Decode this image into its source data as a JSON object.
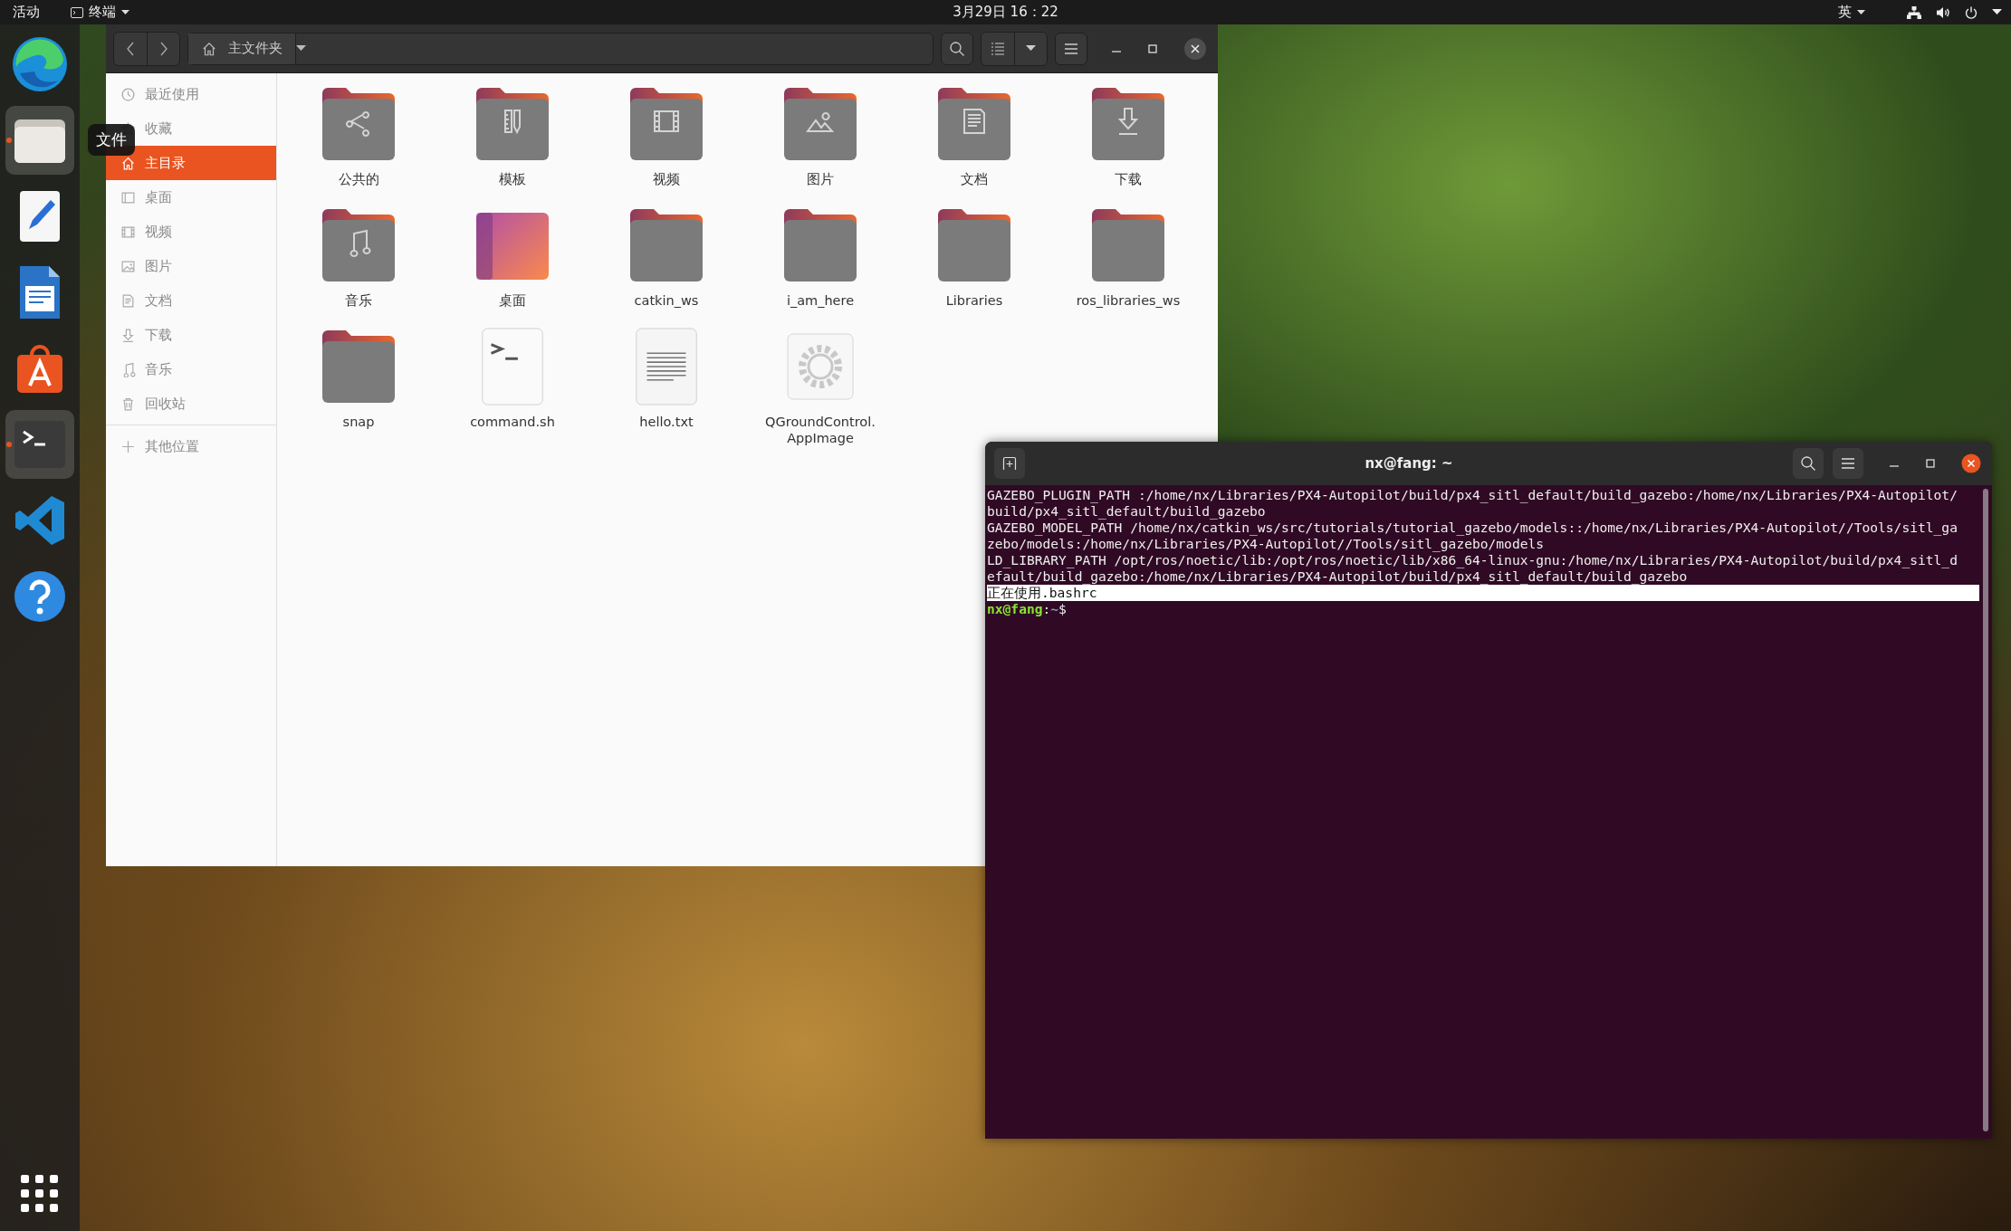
{
  "top_bar": {
    "activities": "活动",
    "app_menu": "终端",
    "clock": "3月29日 16：22",
    "input_method": "英"
  },
  "dock": [
    {
      "running": false,
      "highlighted": false
    },
    {
      "running": true,
      "highlighted": true
    },
    {
      "running": false,
      "highlighted": false
    },
    {
      "running": false,
      "highlighted": false
    },
    {
      "running": false,
      "highlighted": false
    },
    {
      "running": true,
      "highlighted": true
    },
    {
      "running": false,
      "highlighted": false
    },
    {
      "running": false,
      "highlighted": false
    }
  ],
  "dock_tooltip": "文件",
  "files_window": {
    "path": "主文件夹",
    "sidebar": [
      {
        "label": "最近使用",
        "selected": false
      },
      {
        "label": "收藏",
        "selected": false
      },
      {
        "label": "主目录",
        "selected": true
      },
      {
        "label": "桌面",
        "selected": false
      },
      {
        "label": "视频",
        "selected": false
      },
      {
        "label": "图片",
        "selected": false
      },
      {
        "label": "文档",
        "selected": false
      },
      {
        "label": "下载",
        "selected": false
      },
      {
        "label": "音乐",
        "selected": false
      },
      {
        "label": "回收站",
        "selected": false
      }
    ],
    "other_locations": "其他位置",
    "items": [
      {
        "name": "公共的",
        "kind": "folder"
      },
      {
        "name": "模板",
        "kind": "folder"
      },
      {
        "name": "视频",
        "kind": "folder"
      },
      {
        "name": "图片",
        "kind": "folder"
      },
      {
        "name": "文档",
        "kind": "folder"
      },
      {
        "name": "下载",
        "kind": "folder"
      },
      {
        "name": "音乐",
        "kind": "folder"
      },
      {
        "name": "桌面",
        "kind": "desktop"
      },
      {
        "name": "catkin_ws",
        "kind": "folder"
      },
      {
        "name": "i_am_here",
        "kind": "folder"
      },
      {
        "name": "Libraries",
        "kind": "folder"
      },
      {
        "name": "ros_libraries_ws",
        "kind": "folder"
      },
      {
        "name": "snap",
        "kind": "folder"
      },
      {
        "name": "command.sh",
        "kind": "script"
      },
      {
        "name": "hello.txt",
        "kind": "text"
      },
      {
        "name": "QGroundControl.\nAppImage",
        "kind": "app"
      }
    ]
  },
  "terminal": {
    "title": "nx@fang: ~",
    "lines": [
      {
        "text": "GAZEBO_PLUGIN_PATH :/home/nx/Libraries/PX4-Autopilot/build/px4_sitl_default/build_gazebo:/home/nx/Libraries/PX4-Autopilot/",
        "highlighted": false
      },
      {
        "text": "build/px4_sitl_default/build_gazebo",
        "highlighted": false
      },
      {
        "text": "GAZEBO_MODEL_PATH /home/nx/catkin_ws/src/tutorials/tutorial_gazebo/models::/home/nx/Libraries/PX4-Autopilot//Tools/sitl_ga",
        "highlighted": false
      },
      {
        "text": "zebo/models:/home/nx/Libraries/PX4-Autopilot//Tools/sitl_gazebo/models",
        "highlighted": false
      },
      {
        "text": "LD_LIBRARY_PATH /opt/ros/noetic/lib:/opt/ros/noetic/lib/x86_64-linux-gnu:/home/nx/Libraries/PX4-Autopilot/build/px4_sitl_d",
        "highlighted": false
      },
      {
        "text": "efault/build_gazebo:/home/nx/Libraries/PX4-Autopilot/build/px4_sitl_default/build_gazebo",
        "highlighted": false
      },
      {
        "text": "正在使用.bashrc",
        "highlighted": true
      }
    ],
    "prompt": {
      "user": "nx@fang",
      "separator": ":",
      "path": "~",
      "symbol": "$"
    }
  }
}
